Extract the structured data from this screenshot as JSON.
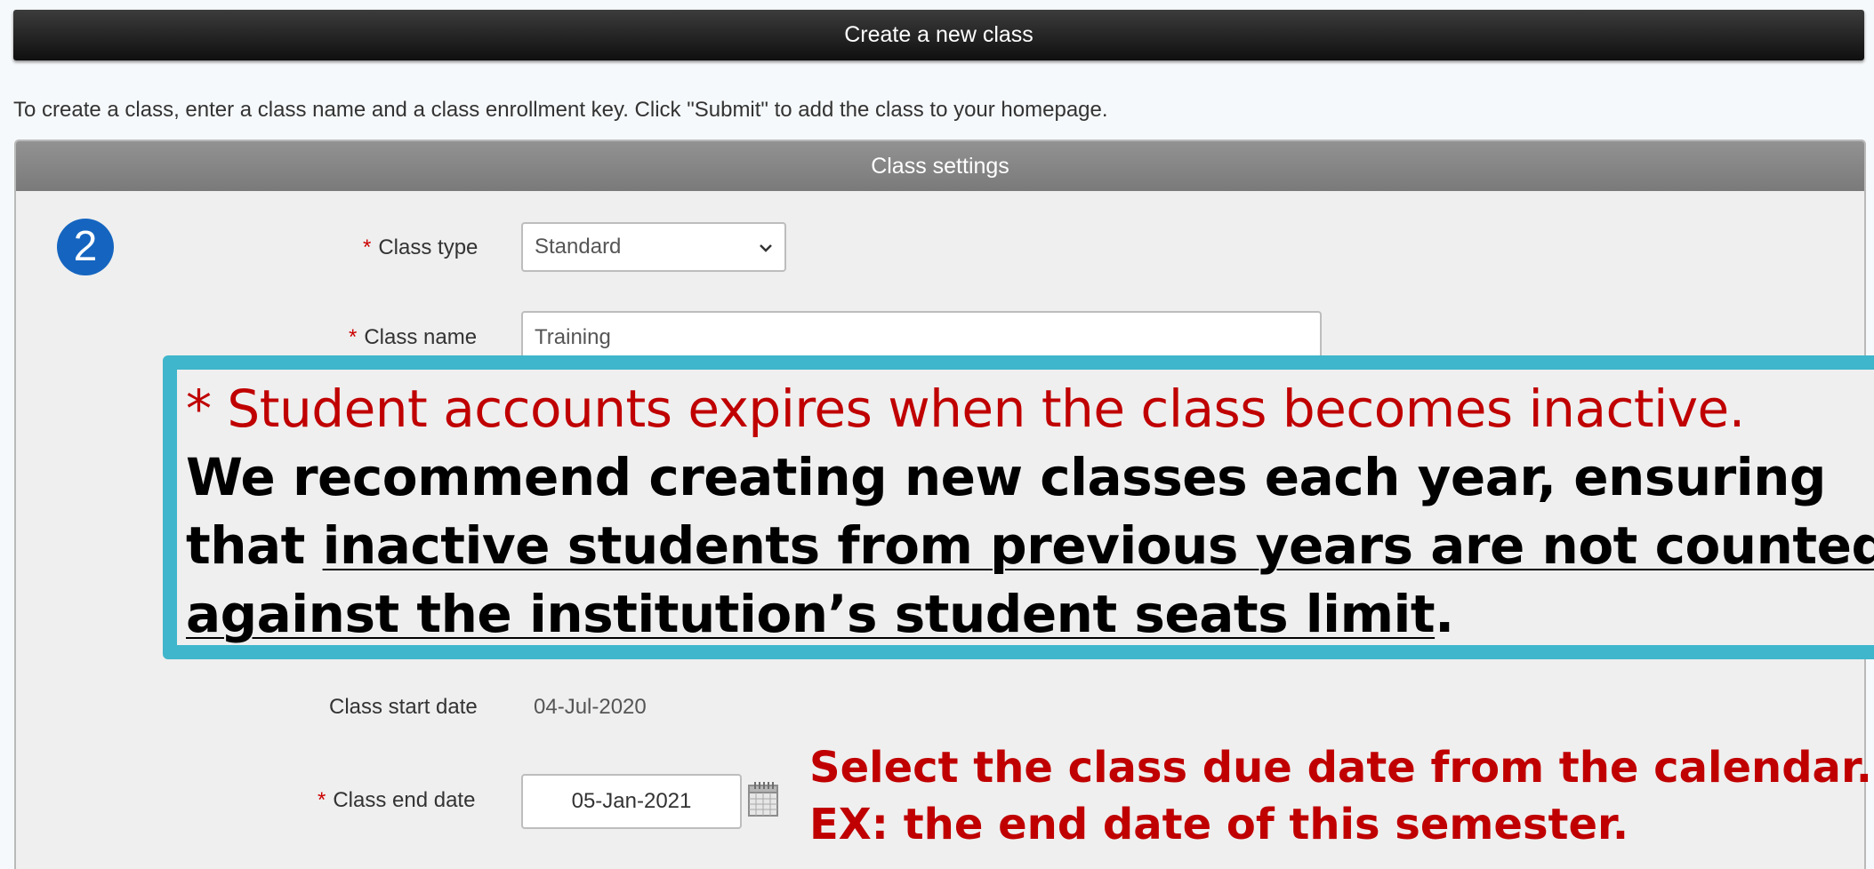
{
  "header": {
    "title": "Create a new class"
  },
  "instructions": "To create a class, enter a class name and a class enrollment key. Click \"Submit\" to add the class to your homepage.",
  "panel": {
    "title": "Class settings"
  },
  "step_badge": "2",
  "form": {
    "required_marker": "*",
    "class_type": {
      "label": "Class type",
      "value": "Standard"
    },
    "class_name": {
      "label": "Class name",
      "value": "Training"
    },
    "class_start_date": {
      "label": "Class start date",
      "value": "04-Jul-2020"
    },
    "class_end_date": {
      "label": "Class end date",
      "value": "05-Jan-2021"
    }
  },
  "note": {
    "line1": "* Student accounts expires when the class becomes inactive.",
    "line2": "We recommend creating new classes each year, ensuring",
    "line3_prefix": "that ",
    "line3_underlined": "inactive students from previous years are not counted",
    "line4_underlined": "against the institution’s student seats limit",
    "line4_suffix": "."
  },
  "hint": {
    "line1": "Select the class due date from the calendar.",
    "line2": "EX: the end date of this semester."
  },
  "icons": {
    "select_chevron": "chevron-down-icon",
    "calendar": "calendar-icon"
  },
  "colors": {
    "header_bg": "#1a1a1a",
    "panel_header_bg": "#8a8a8a",
    "required": "#cc0000",
    "badge": "#1565c0",
    "overlay_border": "#3fb6cb",
    "annotation_red": "#c00000"
  }
}
